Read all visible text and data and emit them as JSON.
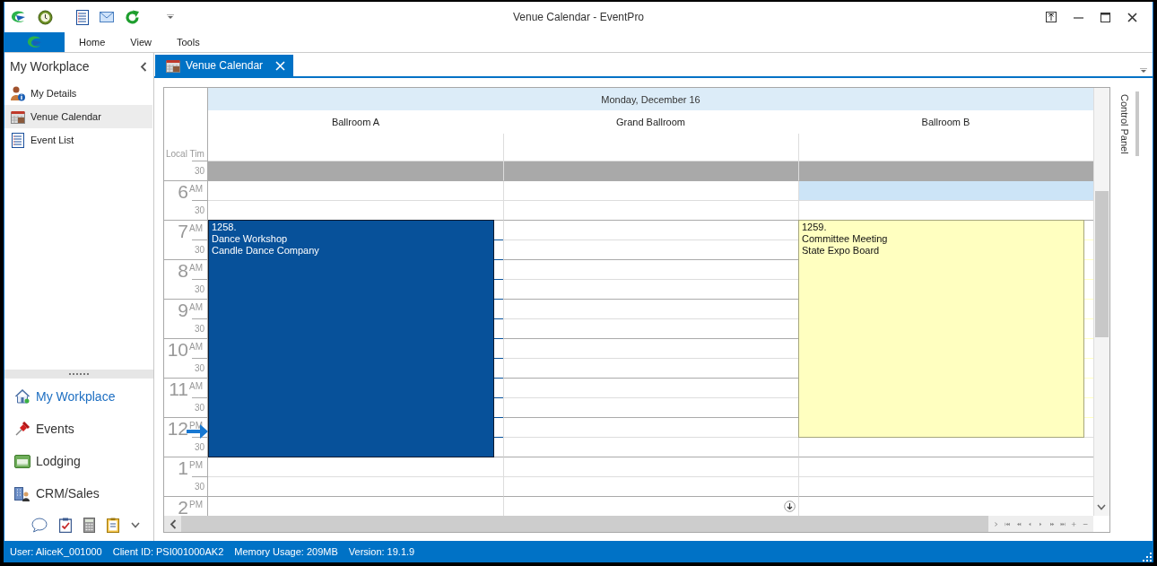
{
  "window": {
    "title": "Venue Calendar - EventPro"
  },
  "ribbon": {
    "menu": [
      "Home",
      "View",
      "Tools"
    ]
  },
  "sidebar": {
    "title": "My Workplace",
    "items": [
      {
        "label": "My Details",
        "kind": "details",
        "selected": false
      },
      {
        "label": "Venue Calendar",
        "kind": "calendar",
        "selected": true
      },
      {
        "label": "Event List",
        "kind": "list",
        "selected": false
      }
    ],
    "nav": [
      {
        "label": "My Workplace",
        "kind": "home",
        "selected": true
      },
      {
        "label": "Events",
        "kind": "pin",
        "selected": false
      },
      {
        "label": "Lodging",
        "kind": "lodging",
        "selected": false
      },
      {
        "label": "CRM/Sales",
        "kind": "crm",
        "selected": false
      }
    ]
  },
  "document_tabs": [
    {
      "label": "Venue Calendar",
      "selected": true
    }
  ],
  "calendar": {
    "date": "Monday, December 16",
    "time_header": "Local Tim",
    "resources": [
      {
        "name": "Ballroom A",
        "events": [
          {
            "number": "1258.",
            "title": "Dance Workshop",
            "client": "Candle Dance Company",
            "color": "#07519a"
          }
        ]
      },
      {
        "name": "Grand Ballroom",
        "more_below": true
      },
      {
        "name": "Ballroom B",
        "events": [
          {
            "number": "1259.",
            "title": "Committee Meeting",
            "client": "State Expo Board",
            "color": "#ffffc0"
          }
        ]
      }
    ],
    "rows": [
      {
        "kind": "half",
        "label": "30",
        "closed": true,
        "cells": [
          {
            "selected": false,
            "booked": false
          },
          {
            "selected": false,
            "booked": false
          },
          {
            "selected": false,
            "booked": false
          }
        ]
      },
      {
        "kind": "hour",
        "hour": "6",
        "meridiem": "AM",
        "closed": false,
        "cells": [
          {
            "selected": false,
            "booked": false
          },
          {
            "selected": false,
            "booked": false
          },
          {
            "selected": true,
            "booked": false
          }
        ]
      },
      {
        "kind": "half",
        "label": "30",
        "closed": false,
        "cells": [
          {
            "selected": false,
            "booked": false
          },
          {
            "selected": false,
            "booked": false
          },
          {
            "selected": false,
            "booked": false
          }
        ]
      },
      {
        "kind": "hour",
        "hour": "7",
        "meridiem": "AM",
        "closed": false,
        "cells": [
          {
            "selected": false,
            "booked": true
          },
          {
            "selected": false,
            "booked": false
          },
          {
            "selected": false,
            "booked": true
          }
        ]
      },
      {
        "kind": "half",
        "label": "30",
        "closed": false,
        "cells": [
          {
            "selected": false,
            "booked": true
          },
          {
            "selected": false,
            "booked": false
          },
          {
            "selected": false,
            "booked": true
          }
        ]
      },
      {
        "kind": "hour",
        "hour": "8",
        "meridiem": "AM",
        "closed": false,
        "cells": [
          {
            "selected": false,
            "booked": true
          },
          {
            "selected": false,
            "booked": false
          },
          {
            "selected": false,
            "booked": true
          }
        ]
      },
      {
        "kind": "half",
        "label": "30",
        "closed": false,
        "cells": [
          {
            "selected": false,
            "booked": true
          },
          {
            "selected": false,
            "booked": false
          },
          {
            "selected": false,
            "booked": true
          }
        ]
      },
      {
        "kind": "hour",
        "hour": "9",
        "meridiem": "AM",
        "closed": false,
        "cells": [
          {
            "selected": false,
            "booked": true
          },
          {
            "selected": false,
            "booked": false
          },
          {
            "selected": false,
            "booked": true
          }
        ]
      },
      {
        "kind": "half",
        "label": "30",
        "closed": false,
        "cells": [
          {
            "selected": false,
            "booked": true
          },
          {
            "selected": false,
            "booked": false
          },
          {
            "selected": false,
            "booked": true
          }
        ]
      },
      {
        "kind": "hour",
        "hour": "10",
        "meridiem": "AM",
        "closed": false,
        "cells": [
          {
            "selected": false,
            "booked": true
          },
          {
            "selected": false,
            "booked": false
          },
          {
            "selected": false,
            "booked": true
          }
        ]
      },
      {
        "kind": "half",
        "label": "30",
        "closed": false,
        "cells": [
          {
            "selected": false,
            "booked": true
          },
          {
            "selected": false,
            "booked": false
          },
          {
            "selected": false,
            "booked": true
          }
        ]
      },
      {
        "kind": "hour",
        "hour": "11",
        "meridiem": "AM",
        "closed": false,
        "cells": [
          {
            "selected": false,
            "booked": true
          },
          {
            "selected": false,
            "booked": false
          },
          {
            "selected": false,
            "booked": true
          }
        ]
      },
      {
        "kind": "half",
        "label": "30",
        "closed": false,
        "cells": [
          {
            "selected": false,
            "booked": true
          },
          {
            "selected": false,
            "booked": false
          },
          {
            "selected": false,
            "booked": true
          }
        ]
      },
      {
        "kind": "hour",
        "hour": "12",
        "meridiem": "PM",
        "closed": false,
        "now": true,
        "cells": [
          {
            "selected": false,
            "booked": true
          },
          {
            "selected": false,
            "booked": false
          },
          {
            "selected": false,
            "booked": true
          }
        ]
      },
      {
        "kind": "half",
        "label": "30",
        "closed": false,
        "cells": [
          {
            "selected": false,
            "booked": true
          },
          {
            "selected": false,
            "booked": false
          },
          {
            "selected": false,
            "booked": false
          }
        ]
      },
      {
        "kind": "hour",
        "hour": "1",
        "meridiem": "PM",
        "closed": false,
        "cells": [
          {
            "selected": false,
            "booked": false
          },
          {
            "selected": false,
            "booked": false
          },
          {
            "selected": false,
            "booked": false
          }
        ]
      },
      {
        "kind": "half",
        "label": "30",
        "closed": false,
        "cells": [
          {
            "selected": false,
            "booked": false
          },
          {
            "selected": false,
            "booked": false
          },
          {
            "selected": false,
            "booked": false
          }
        ]
      },
      {
        "kind": "hour",
        "hour": "2",
        "meridiem": "PM",
        "closed": false,
        "cells": [
          {
            "selected": false,
            "booked": false
          },
          {
            "selected": false,
            "booked": false
          },
          {
            "selected": false,
            "booked": false
          }
        ]
      }
    ]
  },
  "control_panel": {
    "label": "Control Panel"
  },
  "status_bar": [
    "User: AliceK_001000",
    "Client ID: PSI001000AK2",
    "Memory Usage: 209MB",
    "Version: 19.1.9"
  ]
}
